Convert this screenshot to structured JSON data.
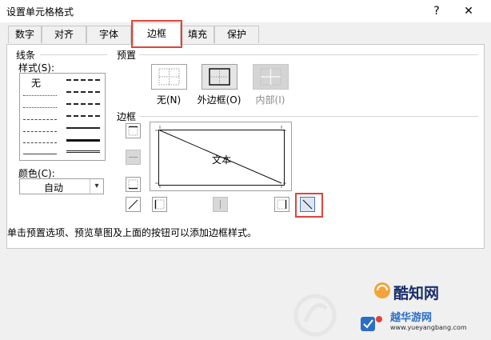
{
  "window": {
    "title": "设置单元格格式",
    "help_label": "?",
    "close_label": "✕"
  },
  "tabs": [
    {
      "label": "数字"
    },
    {
      "label": "对齐"
    },
    {
      "label": "字体"
    },
    {
      "label": "边框",
      "active": true
    },
    {
      "label": "填充"
    },
    {
      "label": "保护"
    }
  ],
  "line_group": {
    "title": "线条",
    "style_label": "样式(S):",
    "none_label": "无",
    "color_label": "颜色(C):",
    "color_value": "自动"
  },
  "presets": {
    "title": "预置",
    "items": [
      {
        "label": "无(N)"
      },
      {
        "label": "外边框(O)",
        "selected": true
      },
      {
        "label": "内部(I)",
        "disabled": true
      }
    ]
  },
  "border": {
    "title": "边框",
    "preview_text": "文本"
  },
  "hint": "单击预置选项、预览草图及上面的按钮可以添加边框样式。",
  "watermark": {
    "brand_text": "酷知网",
    "site_text": "越华游网",
    "url_text": "www.yueyangbang.com"
  },
  "colors": {
    "highlight": "#e0433a",
    "panel_bg": "#ffffff",
    "dialog_bg": "#f0f0f0"
  }
}
